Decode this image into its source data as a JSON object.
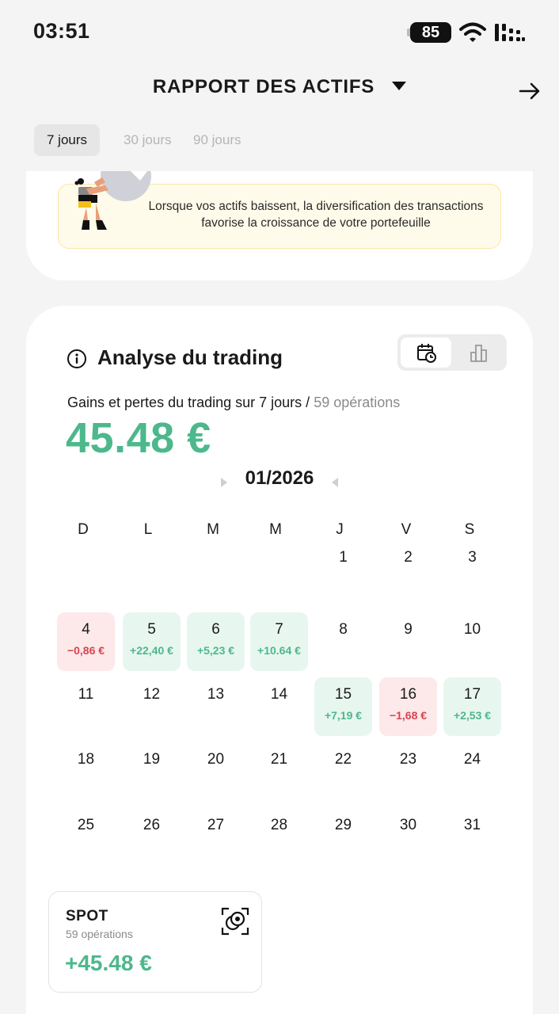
{
  "status_bar": {
    "time": "03:51",
    "battery": "85"
  },
  "header": {
    "title": "RAPPORT DES ACTIFS"
  },
  "periods": [
    {
      "label": "7 jours",
      "active": true
    },
    {
      "label": "30 jours",
      "active": false
    },
    {
      "label": "90 jours",
      "active": false
    }
  ],
  "banner": {
    "text": "Lorsque vos actifs baissent, la diversification des transactions favorise la croissance de votre portefeuille"
  },
  "analysis": {
    "title": "Analyse du trading",
    "subtitle_main": "Gains et pertes du trading sur 7 jours /",
    "subtitle_ops": "59 opérations",
    "total": "45.48 €"
  },
  "calendar": {
    "month": "01/2026",
    "weekdays": [
      "D",
      "L",
      "M",
      "M",
      "J",
      "V",
      "S"
    ],
    "days": [
      {
        "num": "1",
        "row": 0,
        "col": 4
      },
      {
        "num": "2",
        "row": 0,
        "col": 5
      },
      {
        "num": "3",
        "row": 0,
        "col": 6
      },
      {
        "num": "4",
        "row": 1,
        "col": 0,
        "pnl": "−0,86 €",
        "status": "loss"
      },
      {
        "num": "5",
        "row": 1,
        "col": 1,
        "pnl": "+22,40 €",
        "status": "gain"
      },
      {
        "num": "6",
        "row": 1,
        "col": 2,
        "pnl": "+5,23 €",
        "status": "gain"
      },
      {
        "num": "7",
        "row": 1,
        "col": 3,
        "pnl": "+10.64 €",
        "status": "gain"
      },
      {
        "num": "8",
        "row": 1,
        "col": 4
      },
      {
        "num": "9",
        "row": 1,
        "col": 5
      },
      {
        "num": "10",
        "row": 1,
        "col": 6
      },
      {
        "num": "11",
        "row": 2,
        "col": 0
      },
      {
        "num": "12",
        "row": 2,
        "col": 1
      },
      {
        "num": "13",
        "row": 2,
        "col": 2
      },
      {
        "num": "14",
        "row": 2,
        "col": 3
      },
      {
        "num": "15",
        "row": 2,
        "col": 4,
        "pnl": "+7,19 €",
        "status": "gain"
      },
      {
        "num": "16",
        "row": 2,
        "col": 5,
        "pnl": "−1,68 €",
        "status": "loss"
      },
      {
        "num": "17",
        "row": 2,
        "col": 6,
        "pnl": "+2,53 €",
        "status": "gain"
      },
      {
        "num": "18",
        "row": 3,
        "col": 0
      },
      {
        "num": "19",
        "row": 3,
        "col": 1
      },
      {
        "num": "20",
        "row": 3,
        "col": 2
      },
      {
        "num": "21",
        "row": 3,
        "col": 3
      },
      {
        "num": "22",
        "row": 3,
        "col": 4
      },
      {
        "num": "23",
        "row": 3,
        "col": 5
      },
      {
        "num": "24",
        "row": 3,
        "col": 6
      },
      {
        "num": "25",
        "row": 4,
        "col": 0
      },
      {
        "num": "26",
        "row": 4,
        "col": 1
      },
      {
        "num": "27",
        "row": 4,
        "col": 2
      },
      {
        "num": "28",
        "row": 4,
        "col": 3
      },
      {
        "num": "29",
        "row": 4,
        "col": 4
      },
      {
        "num": "30",
        "row": 4,
        "col": 5
      },
      {
        "num": "31",
        "row": 4,
        "col": 6
      }
    ]
  },
  "spot": {
    "name": "SPOT",
    "ops": "59 opérations",
    "value": "+45.48 €"
  },
  "colors": {
    "gain": "#4cb88c",
    "loss": "#d64550",
    "gain_bg": "#e8f6f0",
    "loss_bg": "#fde8ea"
  },
  "icons": {
    "period_next": "arrow-right-icon",
    "title_dropdown": "caret-down-icon",
    "info": "info-icon",
    "calendar_view": "calendar-clock-icon",
    "chart_view": "bar-chart-icon",
    "spot": "spot-coin-icon"
  }
}
